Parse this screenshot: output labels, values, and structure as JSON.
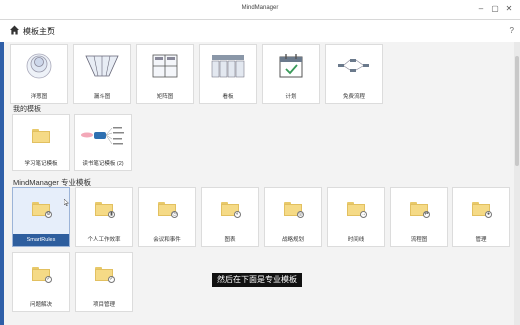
{
  "window": {
    "title": "MindManager"
  },
  "nav": {
    "breadcrumb": "模板主页",
    "caret": "▾",
    "help": "?"
  },
  "top_templates": [
    {
      "label": "洋葱图",
      "icon": "onion-icon"
    },
    {
      "label": "漏斗图",
      "icon": "funnel-icon"
    },
    {
      "label": "矩阵图",
      "icon": "matrix-icon"
    },
    {
      "label": "看板",
      "icon": "kanban-icon"
    },
    {
      "label": "计划",
      "icon": "calendar-icon"
    },
    {
      "label": "免费流程",
      "icon": "flow-icon"
    }
  ],
  "my_templates": {
    "heading": "我的模板",
    "items": [
      {
        "label": "学习笔记模板",
        "icon": "folder-icon"
      },
      {
        "label": "读书笔记模板 (2)",
        "icon": "mindmap-thumb-icon"
      }
    ]
  },
  "pro_templates": {
    "heading": "MindManager 专业模板",
    "items": [
      {
        "label": "SmartRules",
        "icon": "folder-gear-icon",
        "selected": true
      },
      {
        "label": "个人工作效率",
        "icon": "folder-chart-icon"
      },
      {
        "label": "会议和事件",
        "icon": "folder-clock-icon"
      },
      {
        "label": "图表",
        "icon": "folder-chart-icon"
      },
      {
        "label": "战略规划",
        "icon": "folder-target-icon"
      },
      {
        "label": "时间线",
        "icon": "folder-timeline-icon"
      },
      {
        "label": "流程图",
        "icon": "folder-flow-icon"
      },
      {
        "label": "管理",
        "icon": "folder-people-icon"
      },
      {
        "label": "问题解决",
        "icon": "folder-check-icon"
      },
      {
        "label": "项目管理",
        "icon": "folder-check-icon"
      }
    ]
  },
  "subtitle": "然后在下面是专业模板",
  "colors": {
    "accent": "#2e5e9e",
    "folder": "#f5da86",
    "sidebar": "#2f5fa8"
  }
}
